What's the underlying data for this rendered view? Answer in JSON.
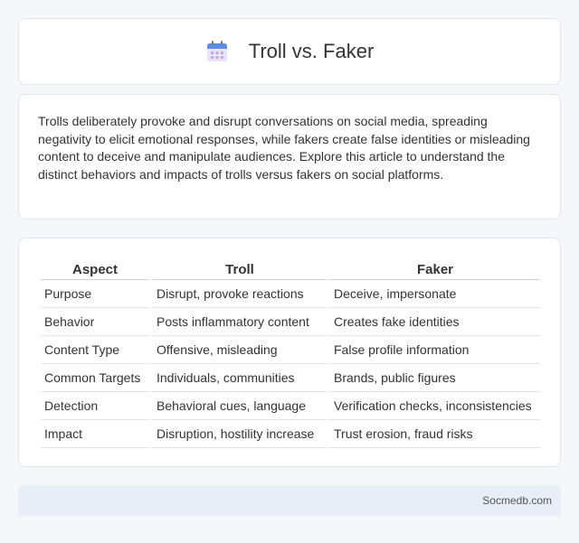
{
  "page": {
    "title": "Troll vs. Faker",
    "icon": "calendar-icon",
    "accent_color": "#6a8fd8"
  },
  "intro": {
    "text": "Trolls deliberately provoke and disrupt conversations on social media, spreading negativity to elicit emotional responses, while fakers create false identities or misleading content to deceive and manipulate audiences. Explore this article to understand the distinct behaviors and impacts of trolls versus fakers on social platforms."
  },
  "table": {
    "headers": [
      "Aspect",
      "Troll",
      "Faker"
    ],
    "rows": [
      [
        "Purpose",
        "Disrupt, provoke reactions",
        "Deceive, impersonate"
      ],
      [
        "Behavior",
        "Posts inflammatory content",
        "Creates fake identities"
      ],
      [
        "Content Type",
        "Offensive, misleading",
        "False profile information"
      ],
      [
        "Common Targets",
        "Individuals, communities",
        "Brands, public figures"
      ],
      [
        "Detection",
        "Behavioral cues, language",
        "Verification checks, inconsistencies"
      ],
      [
        "Impact",
        "Disruption, hostility increase",
        "Trust erosion, fraud risks"
      ]
    ]
  },
  "footer": {
    "text": "Socmedb.com"
  }
}
